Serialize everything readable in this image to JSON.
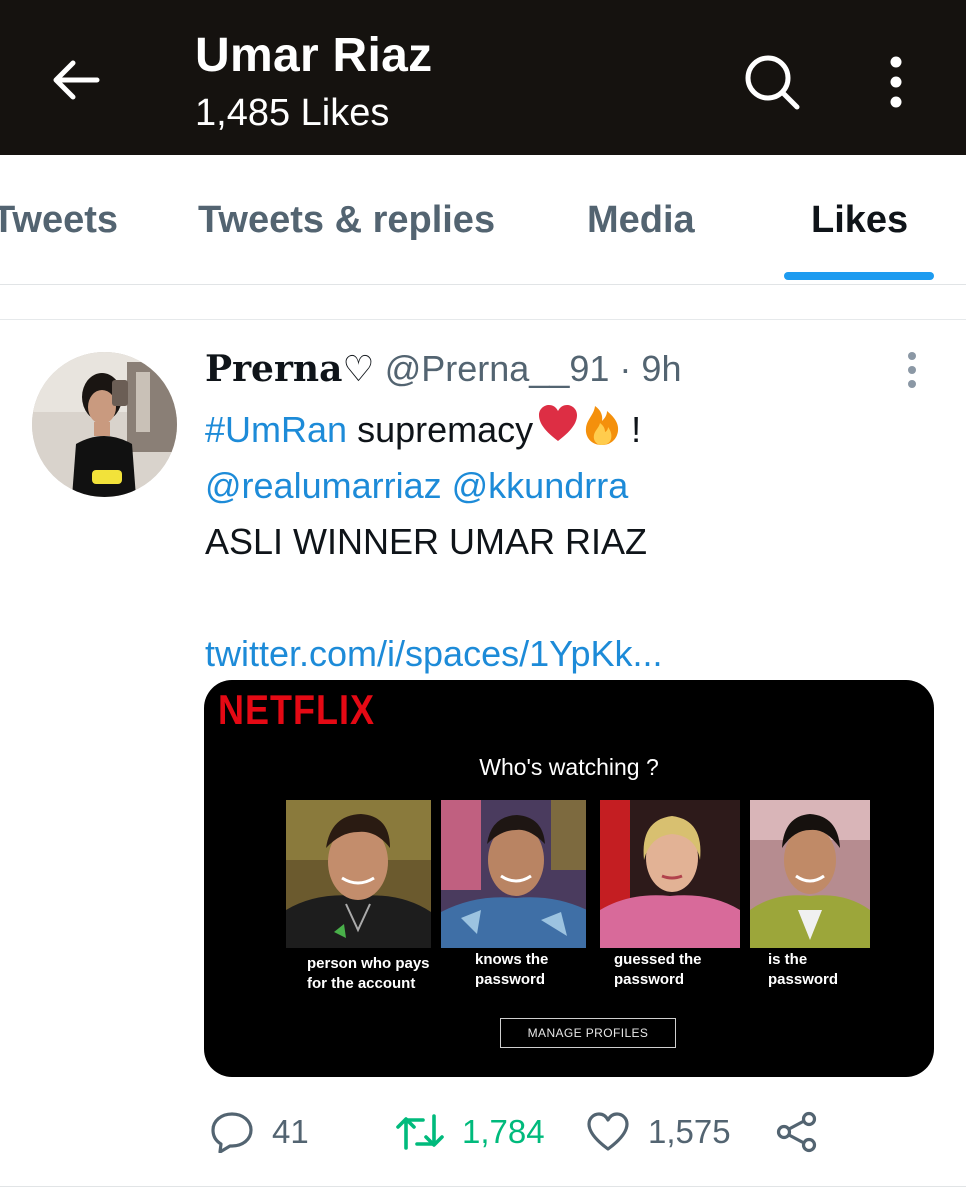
{
  "header": {
    "title": "Umar Riaz",
    "subtitle": "1,485 Likes"
  },
  "tabs": [
    {
      "label": "Tweets"
    },
    {
      "label": "Tweets & replies"
    },
    {
      "label": "Media"
    },
    {
      "label": "Likes"
    }
  ],
  "active_tab": "Likes",
  "tweet": {
    "display_name": "Prerna♡",
    "handle": "@Prerna__91",
    "separator": "·",
    "time": "9h",
    "hashtag": "#UmRan",
    "text_line1_rest": "supremacy",
    "emojis": [
      "heart-emoji",
      "fire-emoji"
    ],
    "exclaim": "!",
    "mentions": [
      "@realumarriaz",
      "@kkundrra"
    ],
    "text_line3": "ASLI WINNER UMAR RIAZ",
    "link": "twitter.com/i/spaces/1YpKk...",
    "media": {
      "logo": "NETFLIX",
      "heading": "Who's watching ?",
      "profiles": [
        {
          "caption": "person who pays for the account"
        },
        {
          "caption": "knows the password"
        },
        {
          "caption": "guessed the password"
        },
        {
          "caption": "is the password"
        }
      ],
      "manage_label": "MANAGE PROFILES"
    },
    "actions": {
      "replies": "41",
      "retweets": "1,784",
      "likes": "1,575"
    }
  },
  "colors": {
    "header_bg": "#15120f",
    "accent_blue": "#1d9bf0",
    "link_blue": "#1d8bd8",
    "retweet_green": "#00ba7c",
    "muted_gray": "#536471",
    "netflix_red": "#e50914"
  }
}
